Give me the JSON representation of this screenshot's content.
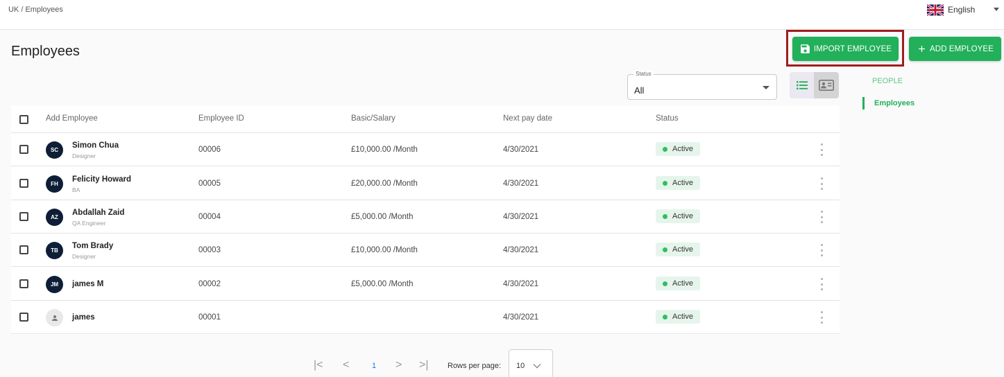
{
  "topbar": {
    "breadcrumb": "UK / Employees",
    "language": "English",
    "flag_icon": "uk-flag-icon"
  },
  "page": {
    "title": "Employees"
  },
  "actions": {
    "import_label": "IMPORT EMPLOYEE",
    "add_label": "ADD EMPLOYEE",
    "accent": "#22b05a",
    "highlight": "#a01c1c"
  },
  "filter": {
    "status_label": "Status",
    "status_value": "All"
  },
  "sidenav": {
    "heading": "PEOPLE",
    "item": "Employees"
  },
  "table": {
    "columns": [
      "Add Employee",
      "Employee ID",
      "Basic/Salary",
      "Next pay date",
      "Status"
    ],
    "rows": [
      {
        "initials": "SC",
        "name": "Simon Chua",
        "role": "Designer",
        "id": "00006",
        "salary": "£10,000.00 /Month",
        "pay_date": "4/30/2021",
        "status": "Active"
      },
      {
        "initials": "FH",
        "name": "Felicity Howard",
        "role": "BA",
        "id": "00005",
        "salary": "£20,000.00 /Month",
        "pay_date": "4/30/2021",
        "status": "Active"
      },
      {
        "initials": "AZ",
        "name": "Abdallah Zaid",
        "role": "QA Engineer",
        "id": "00004",
        "salary": "£5,000.00 /Month",
        "pay_date": "4/30/2021",
        "status": "Active"
      },
      {
        "initials": "TB",
        "name": "Tom Brady",
        "role": "Designer",
        "id": "00003",
        "salary": "£10,000.00 /Month",
        "pay_date": "4/30/2021",
        "status": "Active"
      },
      {
        "initials": "JM",
        "name": "james M",
        "role": "",
        "id": "00002",
        "salary": "£5,000.00 /Month",
        "pay_date": "4/30/2021",
        "status": "Active"
      },
      {
        "initials": "",
        "name": "james",
        "role": "",
        "id": "00001",
        "salary": "",
        "pay_date": "4/30/2021",
        "status": "Active"
      }
    ]
  },
  "pagination": {
    "first": "|<",
    "prev": "<",
    "page": "1",
    "next": ">",
    "last": ">|",
    "rows_label": "Rows per page:",
    "rows_value": "10"
  }
}
